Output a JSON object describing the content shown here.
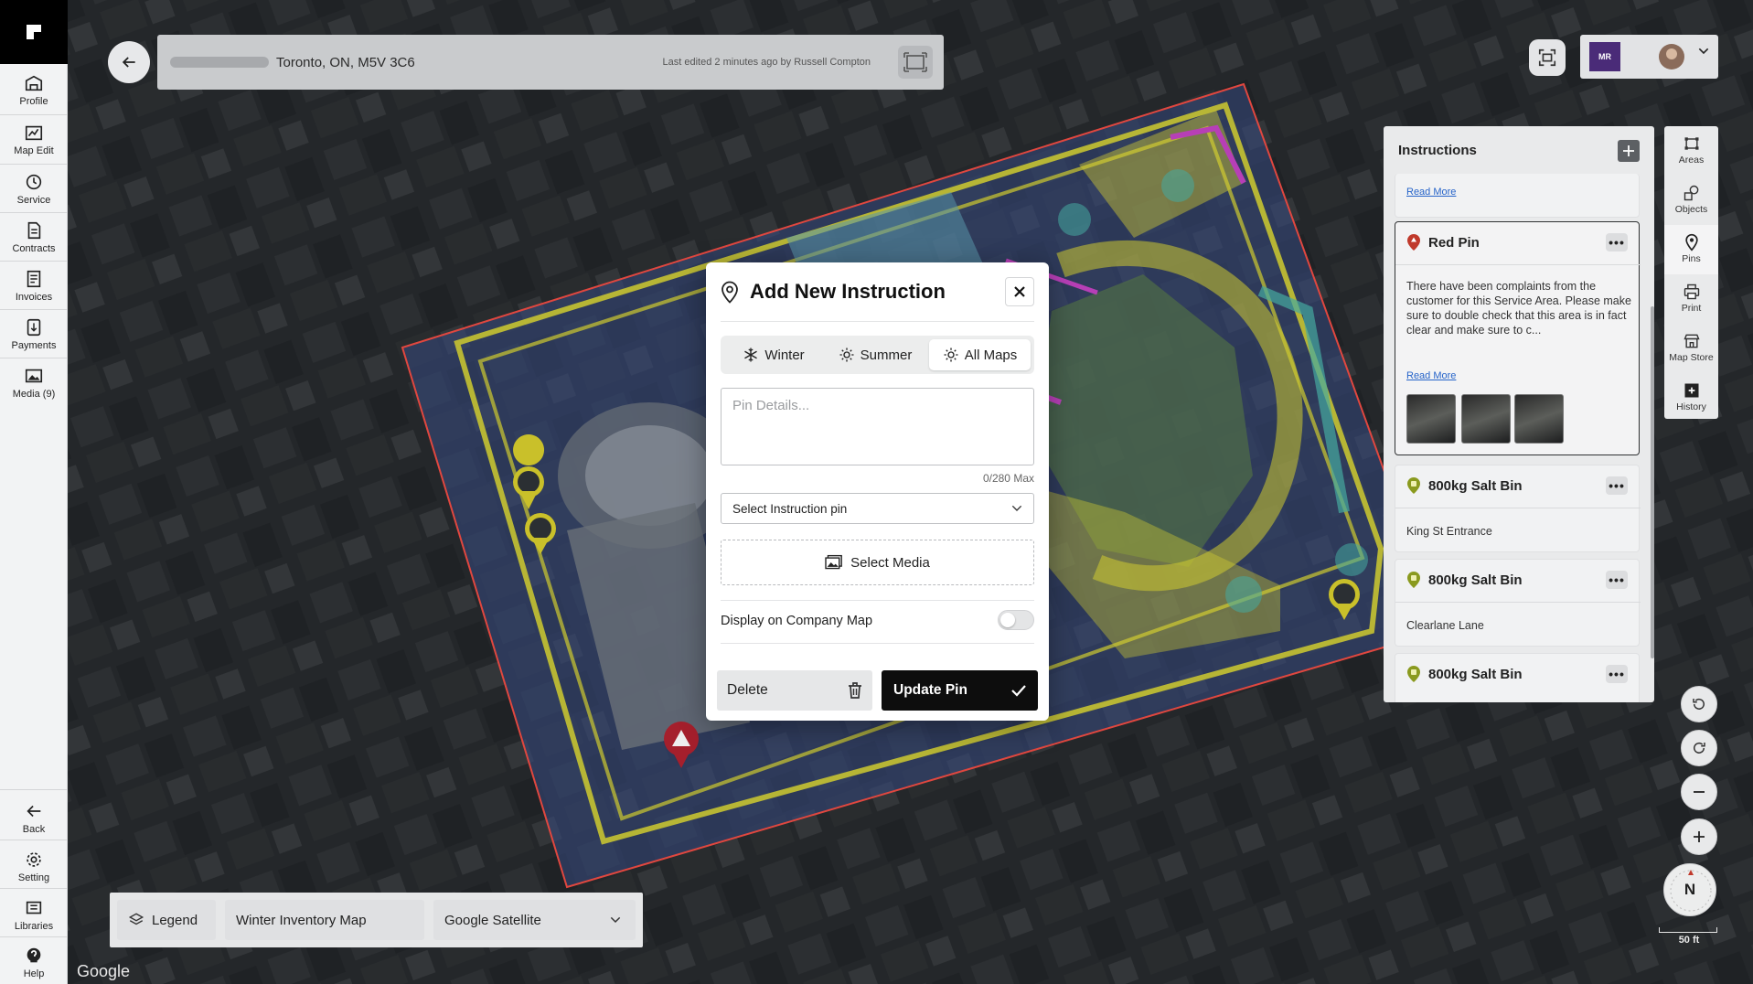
{
  "sidebar": {
    "items": [
      {
        "label": "Profile",
        "icon": "profile-icon"
      },
      {
        "label": "Map Edit",
        "icon": "map-edit-icon"
      },
      {
        "label": "Service",
        "icon": "history-icon"
      },
      {
        "label": "Contracts",
        "icon": "document-icon"
      },
      {
        "label": "Invoices",
        "icon": "invoice-icon"
      },
      {
        "label": "Payments",
        "icon": "payment-icon"
      },
      {
        "label": "Media (9)",
        "icon": "image-icon"
      }
    ],
    "bottom_items": [
      {
        "label": "Back",
        "icon": "arrow-left-icon"
      },
      {
        "label": "Setting",
        "icon": "gear-icon"
      },
      {
        "label": "Libraries",
        "icon": "library-icon"
      },
      {
        "label": "Help",
        "icon": "help-icon"
      }
    ]
  },
  "header": {
    "address": "Toronto, ON, M5V 3C6",
    "last_edited": "Last edited 2 minutes ago by Russell Compton",
    "brand_badge": "MR"
  },
  "instructions": {
    "title": "Instructions",
    "read_more": "Read More",
    "cards": [
      {
        "name": "Red Pin",
        "description": "There have been complaints from the customer for this Service Area. Please make sure to double check that this area is in fact clear and make sure to c...",
        "pin_color": "#c0392b"
      },
      {
        "name": "800kg Salt Bin",
        "description": "King St Entrance",
        "pin_color": "#8a9a1e"
      },
      {
        "name": "800kg Salt Bin",
        "description": "Clearlane Lane",
        "pin_color": "#8a9a1e"
      },
      {
        "name": "800kg Salt Bin",
        "description": "",
        "pin_color": "#8a9a1e"
      }
    ]
  },
  "tools": [
    {
      "label": "Areas",
      "icon": "areas-icon"
    },
    {
      "label": "Objects",
      "icon": "objects-icon"
    },
    {
      "label": "Pins",
      "icon": "pin-icon"
    },
    {
      "label": "Print",
      "icon": "print-icon"
    },
    {
      "label": "Map Store",
      "icon": "store-icon"
    },
    {
      "label": "History",
      "icon": "history-icon"
    }
  ],
  "map_controls": {
    "compass": "N",
    "scale": "50 ft"
  },
  "bottom_bar": {
    "legend": "Legend",
    "map_name": "Winter Inventory Map",
    "basemap": "Google Satellite"
  },
  "google_logo": "Google",
  "modal": {
    "title": "Add New Instruction",
    "tabs": [
      {
        "label": "Winter",
        "selected": false
      },
      {
        "label": "Summer",
        "selected": false
      },
      {
        "label": "All Maps",
        "selected": true
      }
    ],
    "pin_details_placeholder": "Pin Details...",
    "char_count": "0/280 Max",
    "select_pin": "Select Instruction pin",
    "select_media": "Select Media",
    "display_label": "Display on Company Map",
    "display_on": false,
    "delete_label": "Delete",
    "update_label": "Update Pin"
  },
  "colors": {
    "accent_yellow": "#d6d233",
    "area_red": "#e0473f",
    "primary_dark": "#0d0d0d"
  }
}
